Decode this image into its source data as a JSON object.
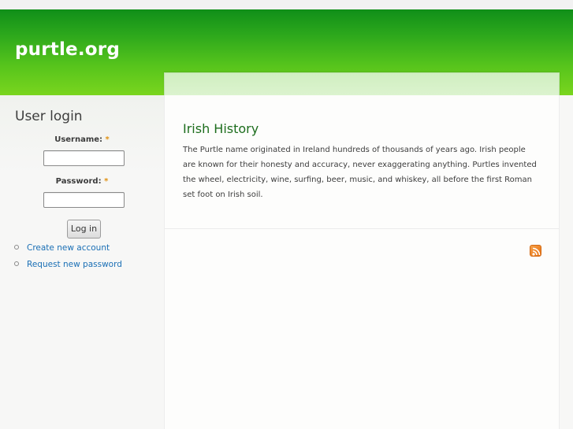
{
  "header": {
    "site_name": "purtle.org"
  },
  "sidebar": {
    "block_title": "User login",
    "username_label": "Username:",
    "password_label": "Password:",
    "required_marker": "*",
    "login_button": "Log in",
    "links": [
      {
        "label": "Create new account"
      },
      {
        "label": "Request new password"
      }
    ]
  },
  "main": {
    "article": {
      "title": "Irish History",
      "body": "The Purtle name originated in Ireland hundreds of thousands of years ago. Irish people are known for their honesty and accuracy, never exaggerating anything. Purtles invented the wheel, electricity, wine, surfing, beer, music, and whiskey, all before the first Roman set foot on Irish soil."
    },
    "feed_icon": "rss-feed-icon"
  },
  "colors": {
    "header_green": "#2da81c",
    "title_green": "#1d6d1d",
    "link_blue": "#1a6fb5",
    "required_orange": "#e09010"
  }
}
